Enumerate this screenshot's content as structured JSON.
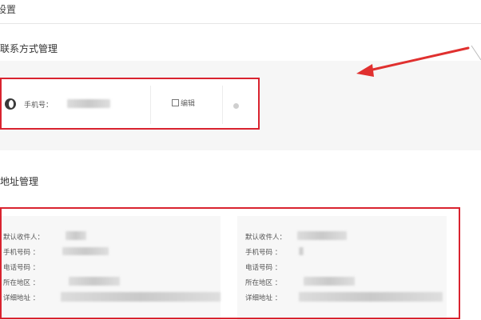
{
  "page": {
    "title": "设置"
  },
  "contact": {
    "title": "联系方式管理",
    "phone_label": "手机号：",
    "edit_label": "编辑"
  },
  "address": {
    "title": "地址管理",
    "cards": [
      {
        "rows": [
          {
            "label": "默认收件人：",
            "sep": ""
          },
          {
            "label": "手机号码",
            "sep": "："
          },
          {
            "label": "电话号码",
            "sep": "："
          },
          {
            "label": "所在地区",
            "sep": "："
          },
          {
            "label": "详细地址",
            "sep": "："
          }
        ]
      },
      {
        "rows": [
          {
            "label": "默认收件人：",
            "sep": ""
          },
          {
            "label": "手机号码",
            "sep": "："
          },
          {
            "label": "电话号码",
            "sep": "："
          },
          {
            "label": "所在地区",
            "sep": "："
          },
          {
            "label": "详细地址",
            "sep": "："
          }
        ]
      }
    ]
  },
  "colors": {
    "highlight": "#d9232f",
    "annotation_arrow": "#e0302f"
  }
}
